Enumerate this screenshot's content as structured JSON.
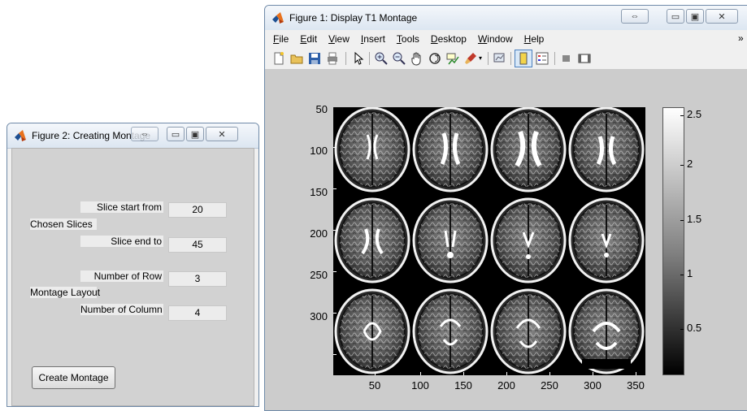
{
  "figure1": {
    "title": "Figure 1: Display T1 Montage",
    "menu": [
      {
        "label": "File",
        "u": "F",
        "rest": "ile"
      },
      {
        "label": "Edit",
        "u": "E",
        "rest": "dit"
      },
      {
        "label": "View",
        "u": "V",
        "rest": "iew"
      },
      {
        "label": "Insert",
        "u": "I",
        "rest": "nsert"
      },
      {
        "label": "Tools",
        "u": "T",
        "rest": "ools"
      },
      {
        "label": "Desktop",
        "u": "D",
        "rest": "esktop"
      },
      {
        "label": "Window",
        "u": "W",
        "rest": "indow"
      },
      {
        "label": "Help",
        "u": "H",
        "rest": "elp"
      }
    ],
    "menu_overflow": "»",
    "toolbar_icons": [
      "new-figure-icon",
      "open-file-icon",
      "save-icon",
      "print-icon",
      "pointer-icon",
      "zoom-in-icon",
      "zoom-out-icon",
      "pan-icon",
      "rotate-3d-icon",
      "data-cursor-icon",
      "brush-icon",
      "brush-dropdown-icon",
      "link-plot-icon",
      "colorbar-toggle-icon",
      "legend-toggle-icon",
      "hide-plot-tools-icon",
      "show-plot-tools-icon"
    ],
    "montage": {
      "yticks": [
        "50",
        "100",
        "150",
        "200",
        "250",
        "300"
      ],
      "xticks": [
        "50",
        "100",
        "150",
        "200",
        "250",
        "300",
        "350"
      ],
      "grid": {
        "rows": 3,
        "cols": 4
      }
    },
    "colorbar_ticks": [
      "2.5",
      "2",
      "1.5",
      "1",
      "0.5"
    ]
  },
  "figure2": {
    "title": "Figure 2: Creating Montage",
    "chosen_slices_label": "Chosen Slices",
    "slice_start_label": "Slice start from",
    "slice_start_value": "20",
    "slice_end_label": "Slice end to",
    "slice_end_value": "45",
    "montage_layout_label": "Montage Layout",
    "num_row_label": "Number of Row",
    "num_row_value": "3",
    "num_col_label": "Number of Column",
    "num_col_value": "4",
    "create_button": "Create Montage"
  }
}
